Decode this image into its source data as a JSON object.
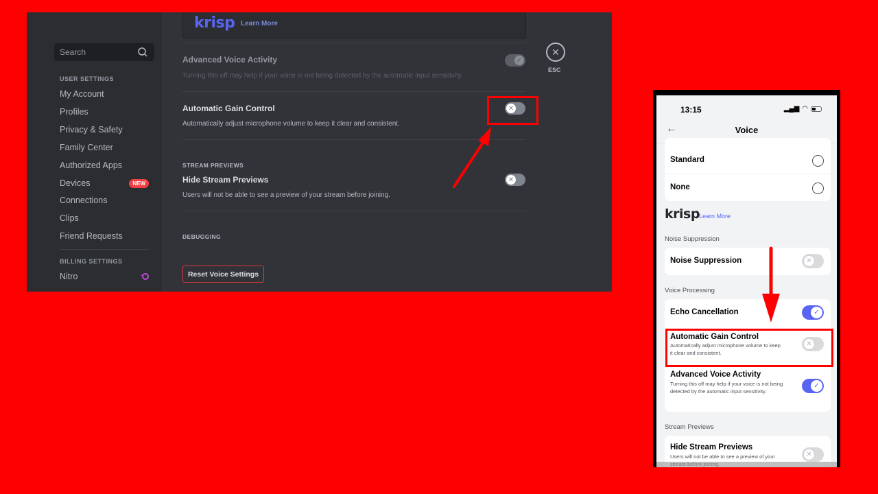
{
  "desktop": {
    "sidebar": {
      "search_placeholder": "Search",
      "user_settings_header": "USER SETTINGS",
      "items": [
        {
          "label": "My Account"
        },
        {
          "label": "Profiles"
        },
        {
          "label": "Privacy & Safety"
        },
        {
          "label": "Family Center"
        },
        {
          "label": "Authorized Apps"
        },
        {
          "label": "Devices",
          "badge": "NEW"
        },
        {
          "label": "Connections"
        },
        {
          "label": "Clips"
        },
        {
          "label": "Friend Requests"
        }
      ],
      "billing_settings_header": "BILLING SETTINGS",
      "billing_items": [
        {
          "label": "Nitro",
          "icon": "nitro-icon"
        }
      ]
    },
    "main": {
      "krisp": {
        "logo": "krisp",
        "learn_more": "Learn More"
      },
      "settings": [
        {
          "title": "Advanced Voice Activity",
          "description": "Turning this off may help if your voice is not being detected by the automatic input sensitivity.",
          "state": "on",
          "disabled": true
        },
        {
          "title": "Automatic Gain Control",
          "description": "Automatically adjust microphone volume to keep it clear and consistent.",
          "state": "off",
          "highlighted": true
        },
        {
          "section": "STREAM PREVIEWS",
          "title": "Hide Stream Previews",
          "description": "Users will not be able to see a preview of your stream before joining.",
          "state": "off"
        }
      ],
      "debugging_header": "DEBUGGING",
      "reset_button": "Reset Voice Settings",
      "close_label": "ESC"
    }
  },
  "mobile": {
    "status_time": "13:15",
    "header_title": "Voice",
    "input_mode_options": [
      {
        "label": "Standard",
        "selected": false
      },
      {
        "label": "None",
        "selected": false
      }
    ],
    "krisp": {
      "logo": "krisp",
      "learn_more": "Learn More"
    },
    "sections": [
      {
        "header": "Noise Suppression",
        "items": [
          {
            "title": "Noise Suppression",
            "state": "off"
          }
        ]
      },
      {
        "header": "Voice Processing",
        "items": [
          {
            "title": "Echo Cancellation",
            "state": "on"
          },
          {
            "title": "Automatic Gain Control",
            "description": "Automatically adjust microphone volume to keep it clear and consistent.",
            "state": "off",
            "highlighted": true
          },
          {
            "title": "Advanced Voice Activity",
            "description": "Turning this off may help if your voice is not being detected by the automatic input sensitivity.",
            "state": "on"
          }
        ]
      },
      {
        "header": "Stream Previews",
        "items": [
          {
            "title": "Hide Stream Previews",
            "description": "Users will not be able to see a preview of your stream before joining.",
            "state": "off"
          }
        ]
      }
    ]
  },
  "colors": {
    "background": "#ff0000",
    "discord_sidebar": "#2b2d31",
    "discord_main": "#313338",
    "blurple": "#5865f2",
    "danger": "#da373c",
    "highlight": "#ff0000"
  },
  "icons": {
    "close": "✕",
    "check": "✓",
    "x_mark": "✕",
    "back": "←"
  }
}
